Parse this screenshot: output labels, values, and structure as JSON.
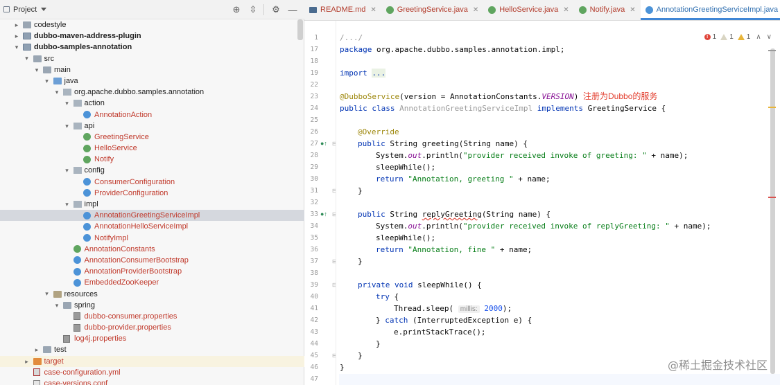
{
  "project_panel": {
    "title": "Project",
    "actions": [
      "globe-crosshair-icon",
      "collapse-all-icon",
      "gear-icon",
      "minimize-icon"
    ],
    "tree": [
      {
        "label": "codestyle",
        "depth": 1,
        "icon": "folder",
        "arrow": "right",
        "style": "plain"
      },
      {
        "label": "dubbo-maven-address-plugin",
        "depth": 1,
        "icon": "module",
        "arrow": "right",
        "style": "bold"
      },
      {
        "label": "dubbo-samples-annotation",
        "depth": 1,
        "icon": "module",
        "arrow": "down",
        "style": "bold"
      },
      {
        "label": "src",
        "depth": 2,
        "icon": "folder",
        "arrow": "down",
        "style": "plain"
      },
      {
        "label": "main",
        "depth": 3,
        "icon": "folder",
        "arrow": "down",
        "style": "plain"
      },
      {
        "label": "java",
        "depth": 4,
        "icon": "source-folder",
        "arrow": "down",
        "style": "plain"
      },
      {
        "label": "org.apache.dubbo.samples.annotation",
        "depth": 5,
        "icon": "package",
        "arrow": "down",
        "style": "plain"
      },
      {
        "label": "action",
        "depth": 6,
        "icon": "package",
        "arrow": "down",
        "style": "plain"
      },
      {
        "label": "AnnotationAction",
        "depth": 7,
        "icon": "class",
        "arrow": "",
        "style": "java"
      },
      {
        "label": "api",
        "depth": 6,
        "icon": "package",
        "arrow": "down",
        "style": "plain"
      },
      {
        "label": "GreetingService",
        "depth": 7,
        "icon": "interface",
        "arrow": "",
        "style": "java"
      },
      {
        "label": "HelloService",
        "depth": 7,
        "icon": "interface",
        "arrow": "",
        "style": "java"
      },
      {
        "label": "Notify",
        "depth": 7,
        "icon": "interface",
        "arrow": "",
        "style": "java"
      },
      {
        "label": "config",
        "depth": 6,
        "icon": "package",
        "arrow": "down",
        "style": "plain"
      },
      {
        "label": "ConsumerConfiguration",
        "depth": 7,
        "icon": "class",
        "arrow": "",
        "style": "java"
      },
      {
        "label": "ProviderConfiguration",
        "depth": 7,
        "icon": "class",
        "arrow": "",
        "style": "java"
      },
      {
        "label": "impl",
        "depth": 6,
        "icon": "package",
        "arrow": "down",
        "style": "plain"
      },
      {
        "label": "AnnotationGreetingServiceImpl",
        "depth": 7,
        "icon": "class",
        "arrow": "",
        "style": "java",
        "selected": true
      },
      {
        "label": "AnnotationHelloServiceImpl",
        "depth": 7,
        "icon": "class",
        "arrow": "",
        "style": "java"
      },
      {
        "label": "NotifyImpl",
        "depth": 7,
        "icon": "class",
        "arrow": "",
        "style": "java"
      },
      {
        "label": "AnnotationConstants",
        "depth": 6,
        "icon": "interface",
        "arrow": "",
        "style": "java"
      },
      {
        "label": "AnnotationConsumerBootstrap",
        "depth": 6,
        "icon": "class",
        "arrow": "",
        "style": "java"
      },
      {
        "label": "AnnotationProviderBootstrap",
        "depth": 6,
        "icon": "class",
        "arrow": "",
        "style": "java"
      },
      {
        "label": "EmbeddedZooKeeper",
        "depth": 6,
        "icon": "class",
        "arrow": "",
        "style": "java"
      },
      {
        "label": "resources",
        "depth": 4,
        "icon": "resources-folder",
        "arrow": "down",
        "style": "plain"
      },
      {
        "label": "spring",
        "depth": 5,
        "icon": "folder",
        "arrow": "down",
        "style": "plain"
      },
      {
        "label": "dubbo-consumer.properties",
        "depth": 6,
        "icon": "properties",
        "arrow": "",
        "style": "java"
      },
      {
        "label": "dubbo-provider.properties",
        "depth": 6,
        "icon": "properties",
        "arrow": "",
        "style": "java"
      },
      {
        "label": "log4j.properties",
        "depth": 5,
        "icon": "properties",
        "arrow": "",
        "style": "java"
      },
      {
        "label": "test",
        "depth": 3,
        "icon": "folder",
        "arrow": "right",
        "style": "plain"
      },
      {
        "label": "target",
        "depth": 2,
        "icon": "target-folder",
        "arrow": "right",
        "style": "java",
        "excluded": true
      },
      {
        "label": "case-configuration.yml",
        "depth": 2,
        "icon": "yml",
        "arrow": "",
        "style": "java"
      },
      {
        "label": "case-versions.conf",
        "depth": 2,
        "icon": "conf",
        "arrow": "",
        "style": "java"
      }
    ]
  },
  "tabs": [
    {
      "label": "README.md",
      "icon": "markdown",
      "active": false
    },
    {
      "label": "GreetingService.java",
      "icon": "interface",
      "active": false
    },
    {
      "label": "HelloService.java",
      "icon": "interface",
      "active": false
    },
    {
      "label": "Notify.java",
      "icon": "interface",
      "active": false
    },
    {
      "label": "AnnotationGreetingServiceImpl.java",
      "icon": "class",
      "active": true
    }
  ],
  "inspections": {
    "errors": "1",
    "warnings": "1",
    "weak_warnings": "1"
  },
  "editor": {
    "line_numbers": [
      "1",
      "17",
      "18",
      "19",
      "22",
      "23",
      "24",
      "25",
      "26",
      "27",
      "28",
      "29",
      "30",
      "31",
      "32",
      "33",
      "34",
      "35",
      "36",
      "37",
      "38",
      "39",
      "40",
      "41",
      "42",
      "43",
      "44",
      "45",
      "46",
      "47"
    ],
    "gutter_marks": {
      "9": "implements-icon",
      "15": "implements-icon"
    },
    "code": {
      "l0": "/.../",
      "l1_kw": "package",
      "l1_rest": " org.apache.dubbo.samples.annotation.impl;",
      "l3_kw": "import",
      "l3_fold": "...",
      "l5_ann": "@DubboService",
      "l5_a": "(version = AnnotationConstants.",
      "l5_fld": "VERSION",
      "l5_b": ")",
      "l5_cn": "注册为Dubbo的服务",
      "l6_kw1": "public class ",
      "l6_cls": "AnnotationGreetingServiceImpl",
      "l6_kw2": " implements ",
      "l6_rest": "GreetingService {",
      "l8_ann": "@Override",
      "l9_kw": "public ",
      "l9_rest": "String greeting(String name) {",
      "l10_a": "System.",
      "l10_fld": "out",
      "l10_b": ".println(",
      "l10_str": "\"provider received invoke of greeting: \"",
      "l10_c": " + name);",
      "l11": "sleepWhile();",
      "l12_kw": "return ",
      "l12_str": "\"Annotation, greeting \"",
      "l12_rest": " + name;",
      "l13": "}",
      "l15_kw": "public ",
      "l15_a": "String ",
      "l15_wavy": "replyGreeting",
      "l15_b": "(String name) {",
      "l16_a": "System.",
      "l16_fld": "out",
      "l16_b": ".println(",
      "l16_str": "\"provider received invoke of replyGreeting: \"",
      "l16_c": " + name);",
      "l17": "sleepWhile();",
      "l18_kw": "return ",
      "l18_str": "\"Annotation, fine \"",
      "l18_rest": " + name;",
      "l19": "}",
      "l21_kw": "private void ",
      "l21_rest": "sleepWhile() {",
      "l22_kw": "try ",
      "l22_rest": "{",
      "l23_a": "Thread.sleep( ",
      "l23_hint": "millis:",
      "l23_num": " 2000",
      "l23_b": ");",
      "l24_a": "} ",
      "l24_kw": "catch ",
      "l24_b": "(InterruptedException e) {",
      "l25": "e.printStackTrace();",
      "l26": "}",
      "l27": "}",
      "l28": "}"
    }
  },
  "watermark": "@稀土掘金技术社区",
  "colors": {
    "accent": "#3f86d6",
    "error": "#e0453a",
    "keyword": "#0033b3",
    "string": "#067d17",
    "annotation": "#9e880d"
  }
}
